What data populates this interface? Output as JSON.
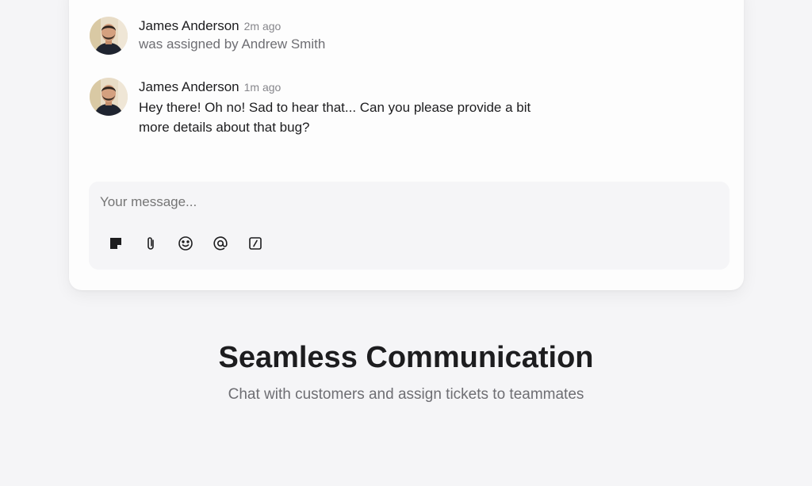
{
  "messages": [
    {
      "author": "James Anderson",
      "time": "2m ago",
      "text": "was assigned by Andrew Smith",
      "avatar_icon": "person-avatar"
    },
    {
      "author": "James Anderson",
      "time": "1m ago",
      "text": "Hey there! Oh no! Sad to hear that... Can you please provide a bit more details about that bug?",
      "avatar_icon": "person-avatar"
    }
  ],
  "composer": {
    "placeholder": "Your message...",
    "tools": [
      "note-icon",
      "attachment-icon",
      "emoji-icon",
      "mention-icon",
      "slash-command-icon"
    ]
  },
  "feature": {
    "title": "Seamless Communication",
    "subtitle": "Chat with customers and assign tickets to teammates"
  }
}
